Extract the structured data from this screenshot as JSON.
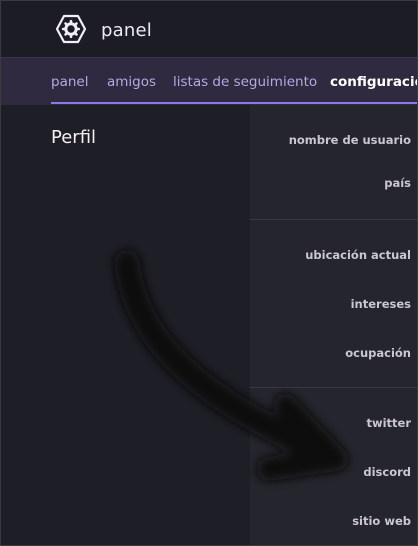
{
  "header": {
    "brand": "panel",
    "logo_icon": "gear-hexagon-icon"
  },
  "tabs": [
    {
      "label": "panel",
      "active": false
    },
    {
      "label": "amigos",
      "active": false
    },
    {
      "label": "listas de seguimiento",
      "active": false
    },
    {
      "label": "configuración",
      "active": true
    }
  ],
  "section": {
    "title": "Perfil"
  },
  "fields": {
    "group1": [
      "nombre de usuario",
      "país"
    ],
    "group2": [
      "ubicación actual",
      "intereses",
      "ocupación"
    ],
    "group3": [
      "twitter",
      "discord",
      "sitio web"
    ]
  },
  "colors": {
    "accent": "#8b78e6",
    "tab_text": "#b6a9e0",
    "background": "#1e1e26"
  }
}
